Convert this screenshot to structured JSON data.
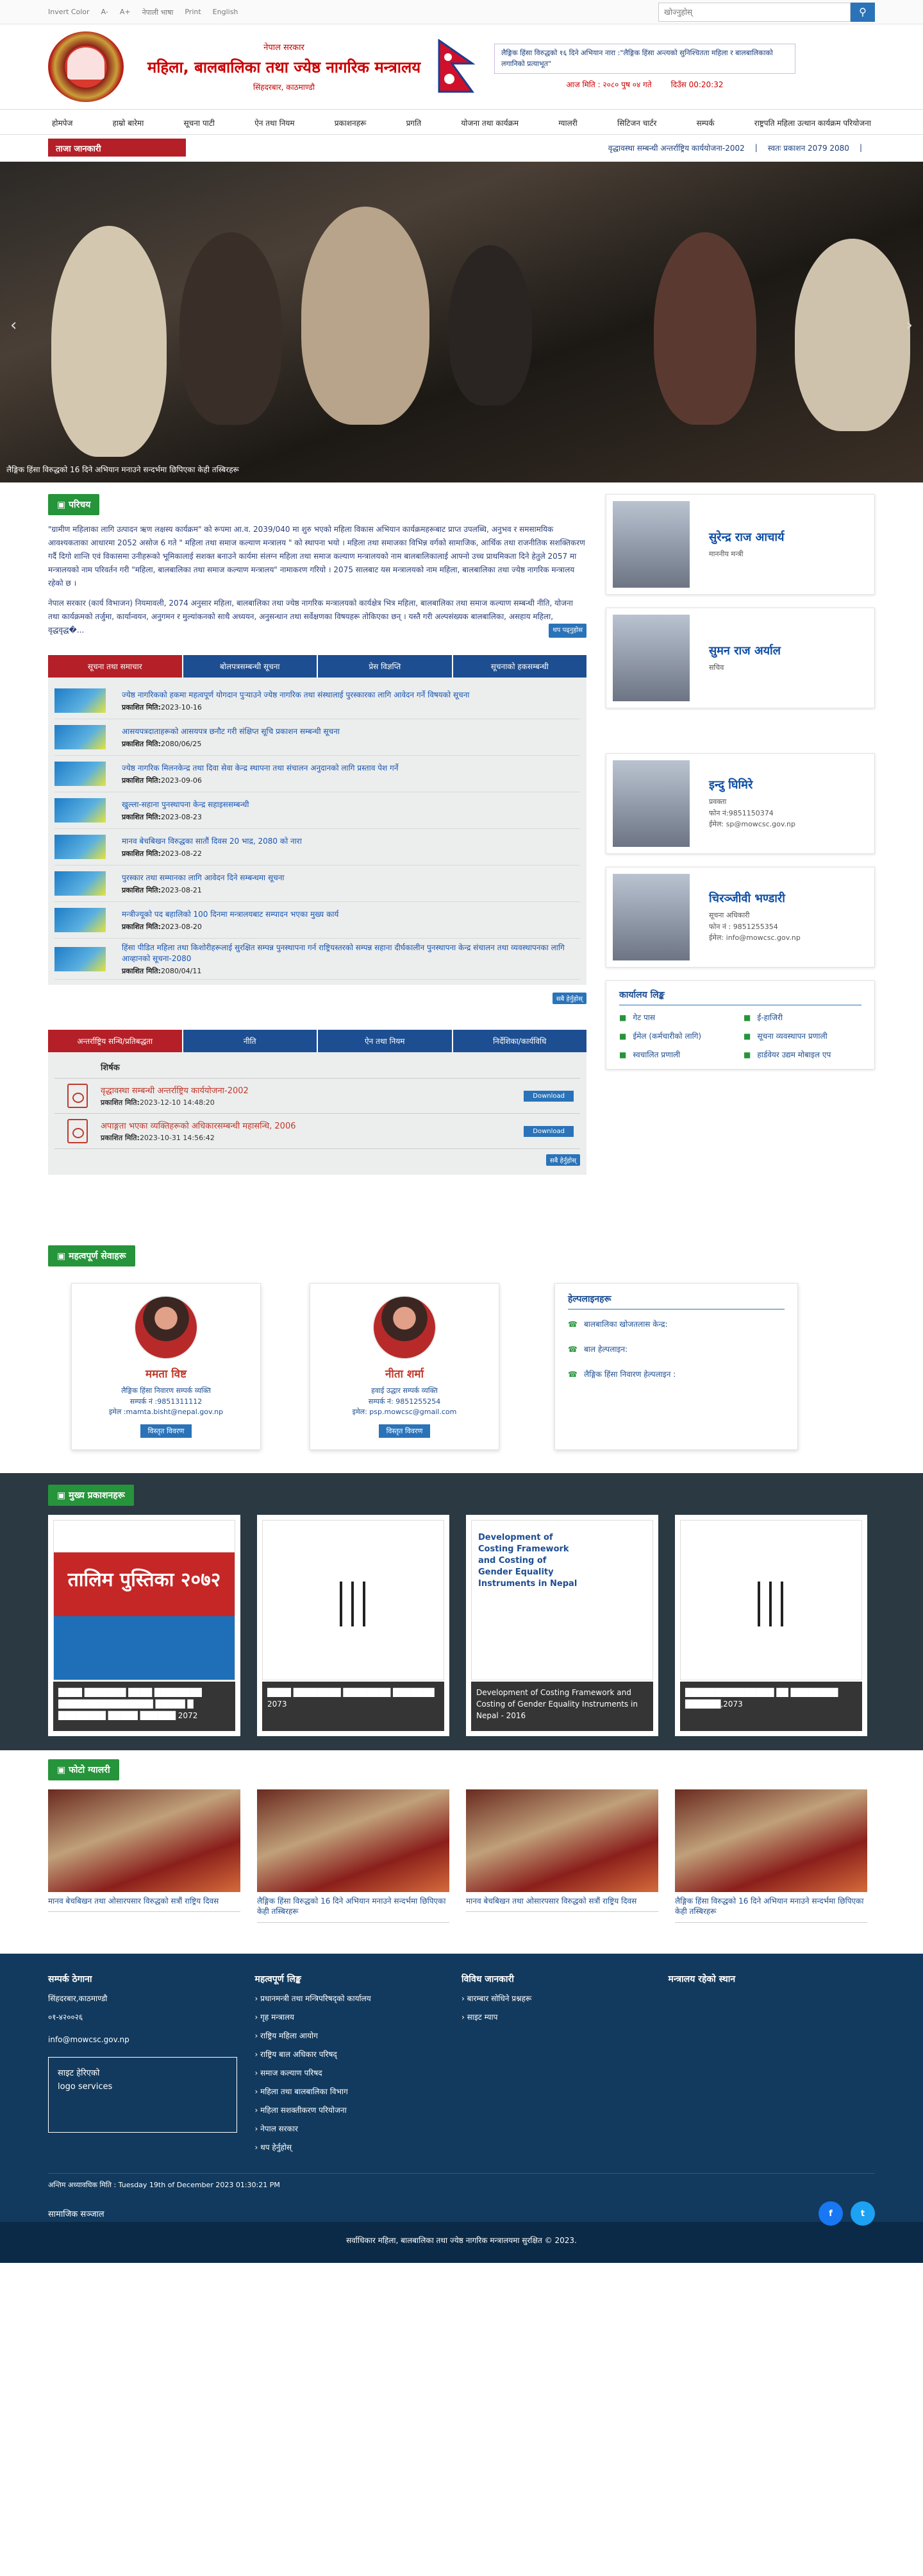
{
  "topbar": {
    "invert": "Invert Color",
    "a_minus": "A-",
    "a_plus": "A+",
    "nepali": "नेपाली भाषा",
    "print": "Print",
    "english": "English",
    "search_placeholder": "खोज्नुहोस्"
  },
  "header": {
    "gov": "नेपाल सरकार",
    "ministry": "महिला, बालबालिका तथा ज्येष्ठ नागरिक मन्त्रालय",
    "location": "सिंहदरबार, काठमाण्डौ",
    "marquee": "लैङ्गिक हिंसा विरुद्धको १६ दिने अभियान नारा :\"लैङ्गिक हिंसा अन्त्यको सुनिश्चितता महिला र बालबालिकाको लगानिको प्रत्याभूत\"",
    "date": "आज मिति : २०८० पुष ०४ गते",
    "time": "दिउँस 00:20:32"
  },
  "nav": [
    "होमपेज",
    "हाम्रो बारेमा",
    "सूचना पाटी",
    "ऐन तथा नियम",
    "प्रकाशनहरू",
    "प्रगति",
    "योजना तथा कार्यक्रम",
    "ग्यालरी",
    "सिटिजन चार्टर",
    "सम्पर्क",
    "राष्ट्रपति महिला उत्थान कार्यक्रम परियोजना"
  ],
  "ticker": {
    "label": "ताजा जानकारी",
    "items": [
      "वृद्धावस्था सम्बन्धी अन्तर्राष्ट्रिय कार्ययोजना-2002",
      "स्वतः प्रकाशन 2079 2080"
    ]
  },
  "slider": {
    "caption": "लैङ्गिक हिंसा विरुद्धको 16 दिने अभियान मनाउने सन्दर्भमा छिपिएका केही तस्बिरहरू",
    "prev": "‹",
    "next": "›"
  },
  "intro": {
    "heading": "परिचय",
    "p1": "\"ग्रामीण महिलाका लागि उत्पादन ऋण लक्षस्य कार्यक्रम\" को रूपमा आ.व. 2039/040 मा शुरु भएको महिला विकास अभियान कार्यक्रमहरूबाट प्राप्त उपलब्धि, अनुभव र समसामयिक आवश्यकताका आधारमा 2052 असोज 6 गते \" महिला तथा समाज कल्याण मन्त्रालय \" को स्थापना भयो । महिला तथा समाजका विभिन्न वर्गको सामाजिक, आर्थिक तथा राजनीतिक सशक्तिकरण गर्दै दिगो शान्ति एवं विकासमा उनीहरूको भूमिकालाई सशक्त बनाउने कार्यमा संलग्न महिला तथा समाज कल्याण मन्त्रालयको नाम बालबालिकालाई आफ्नो उच्च प्राथमिकता दिने हेतुले 2057 मा मन्त्रालयको नाम परिवर्तन गरी \"महिला, बालबालिका तथा समाज कल्याण मन्त्रालय\" नामाकरण गरियो । 2075 सालबाट यस मन्त्रालयको नाम महिला, बालबालिका तथा ज्येष्ठ नागरिक मन्त्रालय रहेको छ ।",
    "p2": "नेपाल सरकार (कार्य विभाजन) नियमावली, 2074 अनुसार महिला, बालबालिका तथा ज्येष्ठ नागरिक मन्त्रालयको कार्यक्षेत्र भित्र महिला, बालबालिका तथा समाज कल्याण सम्बन्धी नीति, योजना तथा कार्यक्रमको तर्जुमा, कार्यान्वयन, अनुगमन र मुल्यांकनको साथै अध्ययन, अनुसन्धान तथा सर्वेक्षणका विषयहरू तोकिएका छन् । यस्तै गरी अल्पसंख्यक बालबालिका, असहाय महिला, वृद्धवृद्ध�...",
    "more": "थप पढ्नुहोस"
  },
  "officials": [
    {
      "name": "सुरेन्द्र राज आचार्य",
      "role": "माननीय मन्त्री",
      "phone": "",
      "email": ""
    },
    {
      "name": "सुमन राज अर्याल",
      "role": "सचिव",
      "phone": "",
      "email": ""
    },
    {
      "name": "इन्दु घिमिरे",
      "role": "प्रवक्ता",
      "phone": "फोन नं:9851150374",
      "email": "ईमेल: sp@mowcsc.gov.np"
    },
    {
      "name": "चिरञ्जीवी भण्डारी",
      "role": "सूचना अधिकारी",
      "phone": "फोन नं : 9851255354",
      "email": "ईमेल: info@mowcsc.gov.np"
    }
  ],
  "notice_tabs": [
    "सूचना तथा समाचार",
    "बोलपत्रसम्बन्धी सूचना",
    "प्रेस विज्ञप्ति",
    "सूचनाको हकसम्बन्धी"
  ],
  "date_label": "प्रकाशित मिति:",
  "notices": [
    {
      "title": "ज्येष्ठ नागरिकको हकमा महत्वपूर्ण योगदान पुर्‍याउने ज्येष्ठ नागरिक तथा संस्थालाई पुरस्कारका लागि आवेदन गर्ने विषयको सूचना",
      "date": "2023-10-16"
    },
    {
      "title": "आसयपत्रदाताहरूको आसयपत्र छनौट गरी संक्षिप्त सूचि प्रकाशन सम्बन्धी सूचना",
      "date": "2080/06/25"
    },
    {
      "title": "ज्येष्ठ नागरिक मिलनकेन्द्र तथा दिवा सेवा केन्द्र स्थापना तथा संचालन अनुदानको लागि प्रस्ताव पेश गर्ने",
      "date": "2023-09-06"
    },
    {
      "title": "खुल्ला-सहाना पुनस्थापना केन्द्र सहाइससम्बन्धी",
      "date": "2023-08-23"
    },
    {
      "title": "मानव बेचबिखन विरुद्धका सातौं दिवस 20 भाद्र, 2080 को नारा",
      "date": "2023-08-22"
    },
    {
      "title": "पुरस्कार तथा सम्मानका लागि आवेदन दिने सम्बन्धमा सूचना",
      "date": "2023-08-21"
    },
    {
      "title": "मन्त्रीज्यूको पद बहालिको 100 दिनमा मन्त्रालयबाट सम्पादन भएका मुख्य कार्य",
      "date": "2023-08-20"
    },
    {
      "title": "हिंसा पीडित महिला तथा किशोरीहरूलाई सुरक्षित सम्पन्न पुनस्थापना गर्न राष्ट्रियस्तरको सम्पन्न सहाना दीर्घकालीन पुनस्थापना केन्द्र संचालन तथा व्यवस्थापनका लागि आव्हानको सूचना-2080",
      "date": "2080/04/11"
    }
  ],
  "view_all": "सबै हेर्नुहोस्",
  "doc_tabs": [
    "अन्तर्राष्ट्रिय सन्धि/प्रतिबद्धता",
    "नीति",
    "ऐन तथा नियम",
    "निर्देशिका/कार्यविधि"
  ],
  "doc_header": "शिर्षक",
  "docs": [
    {
      "title": "वृद्धावस्था सम्बन्धी अन्तर्राष्ट्रिय कार्ययोजना-2002",
      "date": "2023-12-10 14:48:20"
    },
    {
      "title": "अपाङ्गता भएका व्यक्तिहरूको अधिकारसम्बन्धी महासन्धि, 2006",
      "date": "2023-10-31 14:56:42"
    }
  ],
  "download": "Download",
  "office_links": {
    "heading": "कार्यालय लिङ्क",
    "items": [
      "गेट पास",
      "ई-हाजिरी",
      "ईमेल (कर्मचारीको लागि)",
      "सूचना व्यवस्थापन प्रणाली",
      "स्वचालित प्रणाली",
      "हार्डवेयर उद्यम मोबाइल एप"
    ]
  },
  "services": {
    "heading": "महत्वपूर्ण सेवाहरू",
    "people": [
      {
        "name": "ममता विष्ट",
        "role": "लैङ्गिक हिंसा निवारण सम्पर्क व्यक्ति",
        "phone": "सम्पर्क नं :9851311112",
        "email": "इमेल :mamta.bisht@nepal.gov.np",
        "btn": "विस्तृत विवरण"
      },
      {
        "name": "नीता शर्मा",
        "role": "हवाई उद्धार सम्पर्क व्यक्ति",
        "phone": "सम्पर्क नं: 9851255254",
        "email": "इमेल: psp.mowcsc@gmail.com",
        "btn": "विस्तृत विवरण"
      }
    ],
    "helpline": {
      "heading": "हेल्पलाइनहरू",
      "items": [
        "बालबालिका खोजतलास केन्द्र:",
        "बाल हेल्पलाइन:",
        "लैङ्गिक हिंसा निवारण हेल्पलाइन :"
      ]
    }
  },
  "pubs": {
    "heading": "मुख्य प्रकाशनहरू",
    "items": [
      {
        "title": "████ ███████ ████ ████████ ████████████████ █████ █ ████████ █████ ██████ 2072",
        "cover_text": "तालिम पुस्तिका २०७२"
      },
      {
        "title": "████ ████████ ████████ ███████ 2073",
        "cover_text": ""
      },
      {
        "title": "Development of Costing Framework and Costing of Gender Equality Instruments in Nepal - 2016",
        "cover_text": "Development of Costing Framework and Costing of Gender Equality Instruments in Nepal"
      },
      {
        "title": "███████████████ ██ ████████ ██████,2073",
        "cover_text": ""
      }
    ]
  },
  "gallery": {
    "heading": "फोटो ग्यालरी",
    "items": [
      "मानव बेचबिखन तथा ओसारपसार विरुद्धको सत्रौं राष्ट्रिय दिवस",
      "लैङ्गिक हिंसा विरुद्धको 16 दिने अभियान मनाउने सन्दर्भमा छिपिएका केही तस्बिरहरू",
      "मानव बेचबिखन तथा ओसारपसार विरुद्धको सत्रौं राष्ट्रिय दिवस",
      "लैङ्गिक हिंसा विरुद्धको 16 दिने अभियान मनाउने सन्दर्भमा छिपिएका केही तस्बिरहरू"
    ]
  },
  "footer": {
    "contact": {
      "heading": "सम्पर्क ठेगाना",
      "addr": "सिंहदरबार,काठमाण्डौ",
      "phone": "०१-४२००२६",
      "email": "info@mowcsc.gov.np",
      "counter": "साइट हेरिएको",
      "logo": "logo services"
    },
    "links": {
      "heading": "महत्वपूर्ण लिङ्क",
      "items": [
        "प्रधानमन्त्री तथा मन्त्रिपरिषद्को कार्यालय",
        "गृह मन्त्रालय",
        "राष्ट्रिय महिला आयोग",
        "राष्ट्रिय बाल अधिकार परिषद्",
        "समाज कल्याण परिषद",
        "महिला तथा बालबालिका विभाग",
        "महिला सशक्तीकरण परियोजना",
        "नेपाल सरकार",
        "थप हेर्नुहोस्"
      ]
    },
    "misc": {
      "heading": "विविध जानकारी",
      "items": [
        "बारम्बार सोधिने प्रश्नहरू",
        "साइट म्याप"
      ]
    },
    "map": {
      "heading": "मन्त्रालय रहेको स्थान"
    },
    "updated": "अन्तिम अध्यावधिक मिति : Tuesday 19th of December 2023 01:30:21 PM",
    "social": "सामाजिक सञ्जाल",
    "copy": "सर्वाधिकार महिला, बालबालिका तथा ज्येष्ठ नागरिक मन्त्रालयमा सुरक्षित © 2023."
  }
}
